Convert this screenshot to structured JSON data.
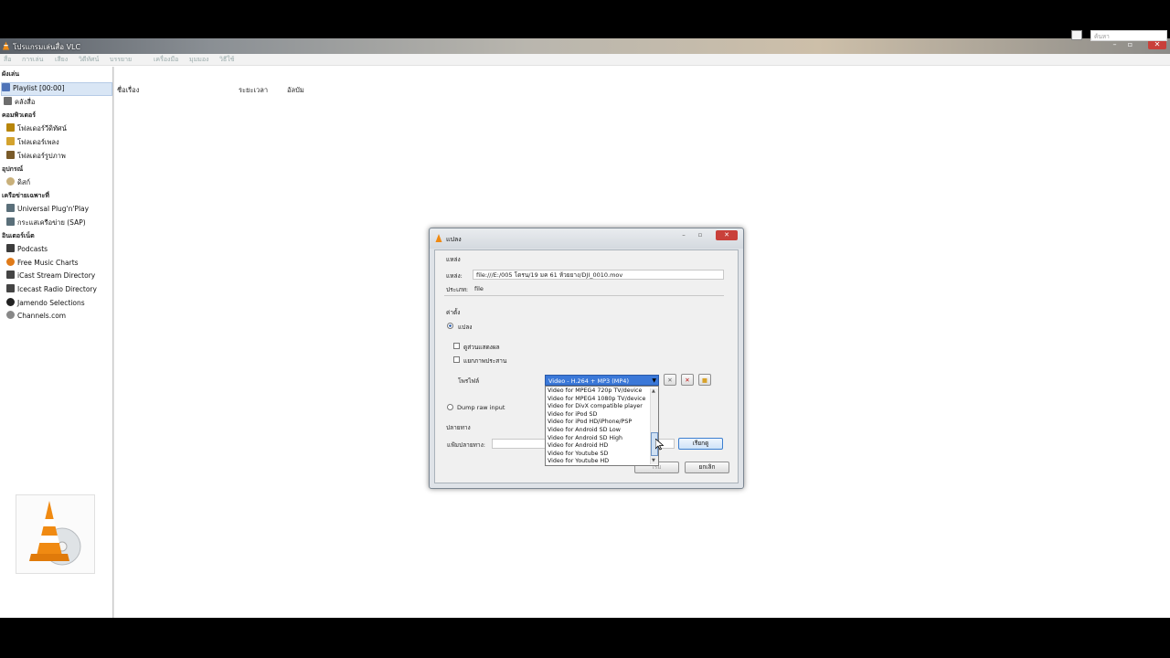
{
  "window": {
    "title": "โปรแกรมเล่นสื่อ VLC",
    "menus": [
      "สื่อ",
      "การเล่น",
      "เสียง",
      "วิดีทัศน์",
      "บรรยาย",
      "เครื่องมือ",
      "มุมมอง",
      "วิธีใช้"
    ]
  },
  "sidebar": {
    "sections": [
      {
        "title": "ผังเล่น",
        "items": [
          {
            "label": "Playlist [00:00]",
            "icon": "playlist-icon",
            "selected": true
          },
          {
            "label": "คลังสื่อ",
            "icon": "library-icon"
          }
        ]
      },
      {
        "title": "คอมพิวเตอร์",
        "items": [
          {
            "label": "โฟลเดอร์วีดิทัศน์",
            "icon": "video-folder-icon"
          },
          {
            "label": "โฟลเดอร์เพลง",
            "icon": "music-folder-icon"
          },
          {
            "label": "โฟลเดอร์รูปภาพ",
            "icon": "pictures-folder-icon"
          }
        ]
      },
      {
        "title": "อุปกรณ์",
        "items": [
          {
            "label": "ดิสก์",
            "icon": "disc-icon"
          }
        ]
      },
      {
        "title": "เครือข่ายเฉพาะที่",
        "items": [
          {
            "label": "Universal Plug'n'Play",
            "icon": "network-icon"
          },
          {
            "label": "กระแสเครือข่าย (SAP)",
            "icon": "network-icon"
          }
        ]
      },
      {
        "title": "อินเตอร์เน็ต",
        "items": [
          {
            "label": "Podcasts",
            "icon": "podcast-icon"
          },
          {
            "label": "Free Music Charts",
            "icon": "music-icon"
          },
          {
            "label": "iCast Stream Directory",
            "icon": "radio-icon"
          },
          {
            "label": "Icecast Radio Directory",
            "icon": "radio-icon"
          },
          {
            "label": "Jamendo Selections",
            "icon": "jamendo-icon"
          },
          {
            "label": "Channels.com",
            "icon": "channels-icon"
          }
        ]
      }
    ]
  },
  "playlist": {
    "columns": [
      "ชื่อเรื่อง",
      "ระยะเวลา",
      "อัลบัม"
    ],
    "search_placeholder": "ค้นหา"
  },
  "dialog": {
    "title": "แปลง",
    "source_group": "แหล่ง",
    "source_label": "แหล่ง:",
    "source_value": "file:///E:/005 โดรน/19 มค 61 ห้วยยาง/DJI_0010.mov",
    "type_label": "ประเภท:",
    "type_value": "file",
    "settings_group": "ค่าตั้ง",
    "convert_radio": "แปลง",
    "show_output_check": "ดูส่วนแสดงผล",
    "deinterlace_check": "แยกภาพประสาน",
    "profile_label": "โพรไฟล์",
    "profile_selected": "Video - H.264 + MP3 (MP4)",
    "dump_raw_radio": "Dump raw input",
    "destination_group": "ปลายทาง",
    "destination_file_label": "แฟ้มปลายทาง:",
    "browse_button": "เรียกดู",
    "start_button": "เริ่ม",
    "cancel_button": "ยกเลิก",
    "profile_options": [
      "Video for MPEG4 720p TV/device",
      "Video for MPEG4 1080p TV/device",
      "Video for DivX compatible player",
      "Video for iPod SD",
      "Video for iPod HD/iPhone/PSP",
      "Video for Android SD Low",
      "Video for Android SD High",
      "Video for Android HD",
      "Video for Youtube SD",
      "Video for Youtube HD"
    ]
  }
}
